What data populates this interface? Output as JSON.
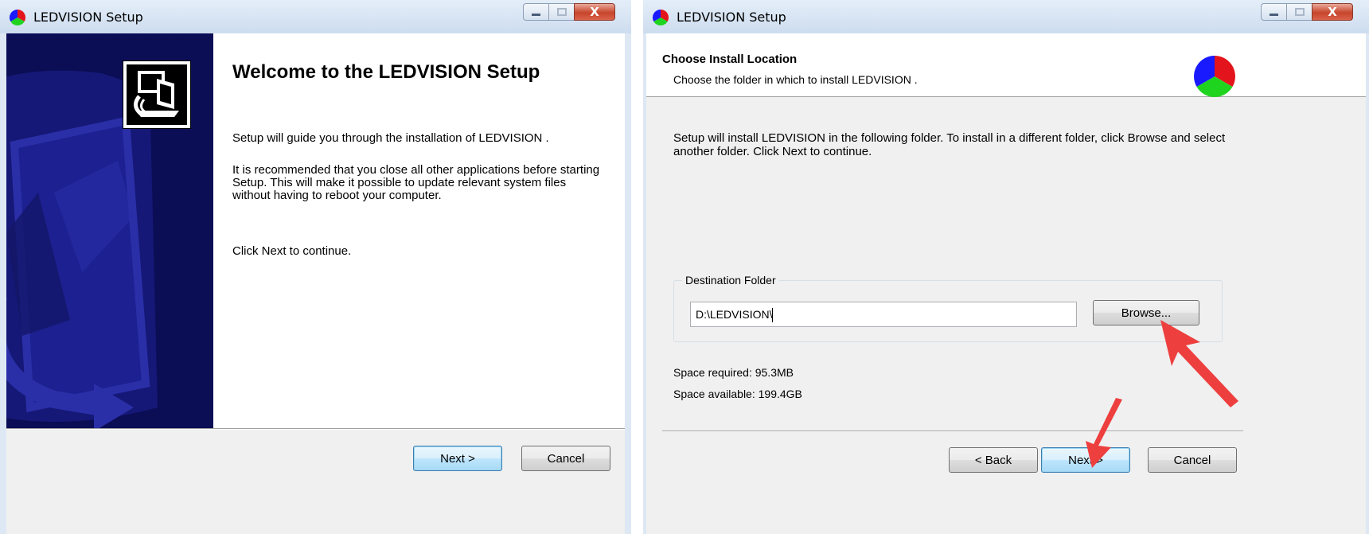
{
  "windows": [
    {
      "title": "LEDVISION  Setup",
      "welcome_title": "Welcome to the LEDVISION  Setup",
      "paragraphs": [
        "Setup will guide you through the installation of LEDVISION .",
        "It is recommended that you close all other applications before starting Setup. This will make it possible to update relevant system files without having to reboot your computer.",
        "Click Next to continue."
      ],
      "buttons": {
        "next": "Next >",
        "cancel": "Cancel"
      }
    },
    {
      "title": "LEDVISION  Setup",
      "header_title": "Choose Install Location",
      "header_subtitle": "Choose the folder in which to install LEDVISION .",
      "body_text": "Setup will install LEDVISION  in the following folder. To install in a different folder, click Browse and select another folder. Click Next to continue.",
      "group_label": "Destination Folder",
      "destination_path": "D:\\LEDVISION\\",
      "browse_label": "Browse...",
      "space_required": "Space required: 95.3MB",
      "space_available": "Space available: 199.4GB",
      "buttons": {
        "back": "< Back",
        "next": "Next >",
        "cancel": "Cancel"
      }
    }
  ],
  "caption": {
    "close_glyph": "X"
  },
  "icons": {
    "window_icon": "ledvision-pie-icon",
    "minimize": "minimize-icon",
    "maximize": "maximize-icon",
    "close": "close-icon",
    "setup_logo": "computer-install-icon",
    "header_icon": "ledvision-pie-icon",
    "annotation": "red-arrow-icon"
  },
  "colors": {
    "sidebar": "#0b0d55",
    "pie_red": "#e3141b",
    "pie_blue": "#1a1aff",
    "pie_green": "#1fd41f",
    "arrow": "#ee3f3f"
  }
}
